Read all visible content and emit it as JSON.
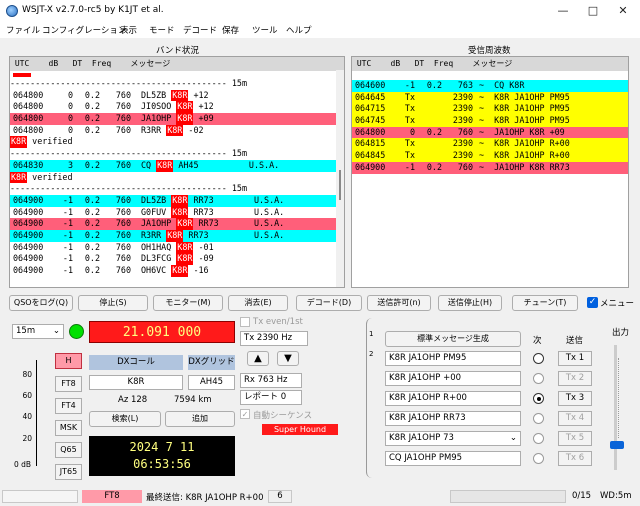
{
  "window": {
    "title": "WSJT-X   v2.7.0-rc5   by K1JT et al."
  },
  "menu": [
    "ファイル",
    "コンフィグレーション",
    "表示",
    "モード",
    "デコード",
    "保存",
    "ツール",
    "ヘルプ"
  ],
  "band_activity": {
    "label": "バンド状況",
    "header": " UTC    dB   DT  Freq    メッセージ",
    "rows": [
      {
        "type": "sep",
        "text": "------------------------------------------- 15m",
        "bg": "#ffffff"
      },
      {
        "type": "row",
        "utc": "064800",
        "db": "0",
        "dt": "0.2",
        "fq": "760",
        "pre": "DL5ZB ",
        "hl": "K8R",
        "post": " +12",
        "bg": "#ffffff"
      },
      {
        "type": "row",
        "utc": "064800",
        "db": "0",
        "dt": "0.2",
        "fq": "760",
        "pre": "JI0SOO ",
        "hl": "K8R",
        "post": " +12",
        "bg": "#ffffff"
      },
      {
        "type": "row",
        "utc": "064800",
        "db": "0",
        "dt": "0.2",
        "fq": "760",
        "pre": "JA1OHP ",
        "hl": "K8R",
        "post": " +09",
        "bg": "#ff5f7a"
      },
      {
        "type": "row",
        "utc": "064800",
        "db": "0",
        "dt": "0.2",
        "fq": "760",
        "pre": "R3RR ",
        "hl": "K8R",
        "post": " -02",
        "bg": "#ffffff"
      },
      {
        "type": "verified",
        "hl": "K8R",
        "post": " verified",
        "bg": "#ffffff"
      },
      {
        "type": "sep",
        "text": "------------------------------------------- 15m",
        "bg": "#ffffff"
      },
      {
        "type": "row",
        "utc": "064830",
        "db": "3",
        "dt": "0.2",
        "fq": "760",
        "pre": "CQ ",
        "hl": "K8R",
        "post": " AH45          U.S.A.",
        "bg": "#00ffff"
      },
      {
        "type": "verified",
        "hl": "K8R",
        "post": " verified",
        "bg": "#ffffff"
      },
      {
        "type": "sep",
        "text": "------------------------------------------- 15m",
        "bg": "#ffffff"
      },
      {
        "type": "row",
        "utc": "064900",
        "db": "-1",
        "dt": "0.2",
        "fq": "760",
        "pre": "DL5ZB ",
        "hl": "K8R",
        "post": " RR73        U.S.A.",
        "bg": "#00ffff"
      },
      {
        "type": "row",
        "utc": "064900",
        "db": "-1",
        "dt": "0.2",
        "fq": "760",
        "pre": "G0FUV ",
        "hl": "K8R",
        "post": " RR73        U.S.A.",
        "bg": "#ffffff"
      },
      {
        "type": "row",
        "utc": "064900",
        "db": "-1",
        "dt": "0.2",
        "fq": "760",
        "pre": "JA1OHP ",
        "hl": "K8R",
        "post": " RR73       U.S.A.",
        "bg": "#ff5f7a"
      },
      {
        "type": "row",
        "utc": "064900",
        "db": "-1",
        "dt": "0.2",
        "fq": "760",
        "pre": "R3RR ",
        "hl": "K8R",
        "post": " RR73         U.S.A.",
        "bg": "#00ffff"
      },
      {
        "type": "row",
        "utc": "064900",
        "db": "-1",
        "dt": "0.2",
        "fq": "760",
        "pre": "OH1HAQ ",
        "hl": "K8R",
        "post": " -01",
        "bg": "#ffffff"
      },
      {
        "type": "row",
        "utc": "064900",
        "db": "-1",
        "dt": "0.2",
        "fq": "760",
        "pre": "DL3FCG ",
        "hl": "K8R",
        "post": " -09",
        "bg": "#ffffff"
      },
      {
        "type": "row",
        "utc": "064900",
        "db": "-1",
        "dt": "0.2",
        "fq": "760",
        "pre": "OH6VC ",
        "hl": "K8R",
        "post": " -16",
        "bg": "#ffffff"
      }
    ]
  },
  "rx_frequency": {
    "label": "受信周波数",
    "header": " UTC    dB   DT  Freq    メッセージ",
    "rows": [
      {
        "utc": "064600",
        "db": "-1",
        "dt": "0.2",
        "fq": "763",
        "msg": "~  CQ K8R",
        "bg": "#00ffff"
      },
      {
        "utc": "064645",
        "db": "Tx",
        "dt": "",
        "fq": "2390",
        "msg": "~  K8R JA1OHP PM95",
        "bg": "#ffff00"
      },
      {
        "utc": "064715",
        "db": "Tx",
        "dt": "",
        "fq": "2390",
        "msg": "~  K8R JA1OHP PM95",
        "bg": "#ffff00"
      },
      {
        "utc": "064745",
        "db": "Tx",
        "dt": "",
        "fq": "2390",
        "msg": "~  K8R JA1OHP PM95",
        "bg": "#ffff00"
      },
      {
        "utc": "064800",
        "db": "0",
        "dt": "0.2",
        "fq": "760",
        "msg": "~  JA1OHP K8R +09",
        "bg": "#ff5f7a"
      },
      {
        "utc": "064815",
        "db": "Tx",
        "dt": "",
        "fq": "2390",
        "msg": "~  K8R JA1OHP R+00",
        "bg": "#ffff00"
      },
      {
        "utc": "064845",
        "db": "Tx",
        "dt": "",
        "fq": "2390",
        "msg": "~  K8R JA1OHP R+00",
        "bg": "#ffff00"
      },
      {
        "utc": "064900",
        "db": "-1",
        "dt": "0.2",
        "fq": "760",
        "msg": "~  JA1OHP K8R RR73",
        "bg": "#ff5f7a"
      }
    ]
  },
  "buttons": {
    "log_qso": "QSOをログ(Q)",
    "stop": "停止(S)",
    "monitor": "モニター(M)",
    "erase": "消去(E)",
    "decode": "デコード(D)",
    "enable_tx": "送信許可(n)",
    "halt_tx": "送信停止(H)",
    "tune": "チューン(T)",
    "menus": "メニュー"
  },
  "controls": {
    "band": "15m",
    "dial_freq": "21.091 000",
    "tx_even": "Tx even/1st",
    "tx_freq": "Tx  2390  Hz",
    "rx_freq": "Rx  763  Hz",
    "report": "レポート 0",
    "auto_seq": "自動シーケンス",
    "super_hound": "Super Hound",
    "hold": "H",
    "modes": [
      "FT8",
      "FT4",
      "MSK",
      "Q65",
      "JT65"
    ],
    "meter_ticks": [
      "80",
      "60",
      "40",
      "20",
      "0 dB"
    ],
    "dx_call_label": "DXコール",
    "dx_grid_label": "DXグリッド",
    "dx_call": "K8R",
    "dx_grid": "AH45",
    "az": "Az  128",
    "dist": "7594 km",
    "lookup": "検索(L)",
    "add": "追加",
    "date": "2024 7 11",
    "time": "06:53:56",
    "up": "▲",
    "down": "▼"
  },
  "tx_messages": {
    "tabs": [
      "1",
      "2"
    ],
    "generate": "標準メッセージ生成",
    "next_label": "次",
    "send_label": "送信",
    "messages": [
      "K8R JA1OHP PM95",
      "K8R JA1OHP +00",
      "K8R JA1OHP R+00",
      "K8R JA1OHP RR73",
      "K8R JA1OHP 73",
      "CQ JA1OHP PM95"
    ],
    "tx_buttons": [
      "Tx 1",
      "Tx 2",
      "Tx 3",
      "Tx 4",
      "Tx 5",
      "Tx 6"
    ],
    "selected": 2,
    "power_label": "出力"
  },
  "status": {
    "mode": "FT8",
    "last_tx": "最終送信: K8R JA1OHP R+00",
    "tx_count": "6",
    "progress": "0/15",
    "wd": "WD:5m"
  }
}
